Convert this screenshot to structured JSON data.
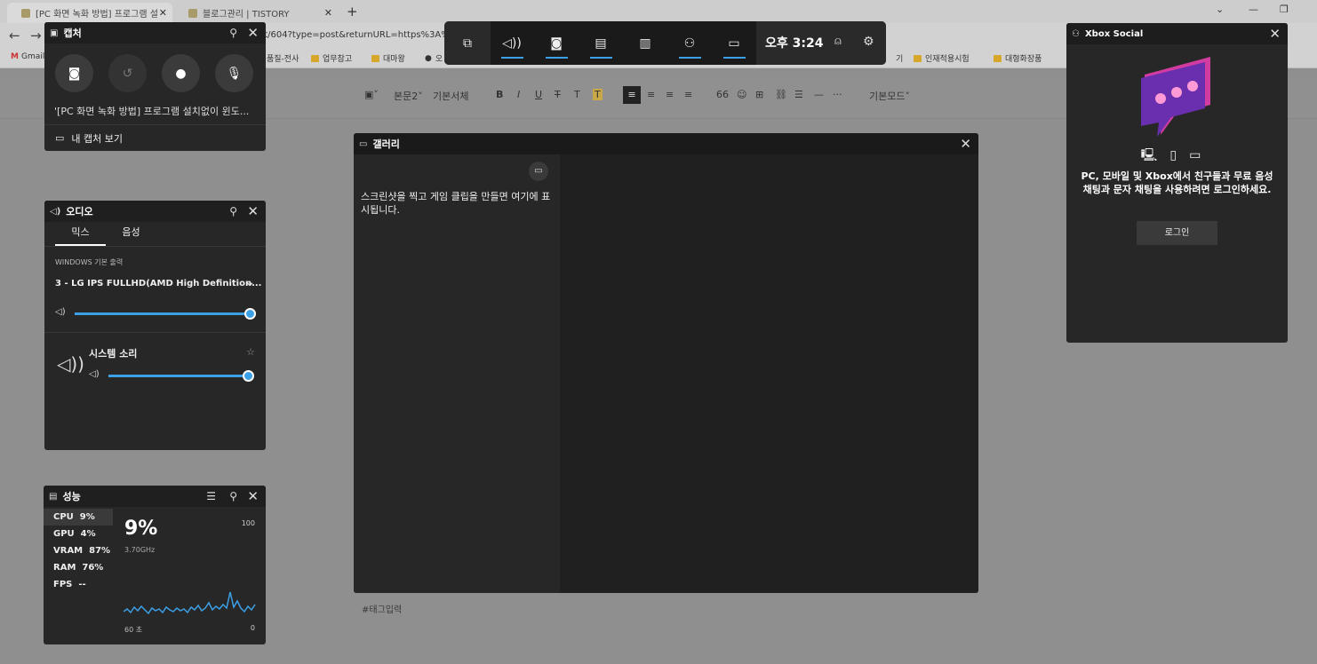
{
  "browser": {
    "tabs": [
      {
        "title": "[PC 화면 녹화 방법] 프로그램 설"
      },
      {
        "title": "블로그관리 | TISTORY"
      }
    ],
    "url": "st/604?type=post&returnURL=https%3A%",
    "bookmarks": [
      "Gmail",
      "품질-전사",
      "업무참고",
      "대마왕",
      "오",
      "기",
      "인재적용시험",
      "대형화장품"
    ],
    "editor": {
      "paragraph_style": "본문2",
      "font": "기본서체",
      "mode": "기본모드",
      "tag_placeholder": "#태그입력"
    }
  },
  "capture": {
    "title": "캡처",
    "caption": "'[PC 화면 녹화 방법] 프로그램 설치없이 윈도...",
    "view_captures": "내 캡처 보기"
  },
  "audio": {
    "title": "오디오",
    "tab_mix": "믹스",
    "tab_voice": "음성",
    "output_label": "WINDOWS 기본 출력",
    "device": "3 - LG IPS FULLHD(AMD High Definition...",
    "master_volume": 0.97,
    "app_name": "시스템 소리",
    "app_volume": 1.0
  },
  "performance": {
    "title": "성능",
    "metrics": [
      {
        "name": "CPU",
        "value": "9%"
      },
      {
        "name": "GPU",
        "value": "4%"
      },
      {
        "name": "VRAM",
        "value": "87%"
      },
      {
        "name": "RAM",
        "value": "76%"
      },
      {
        "name": "FPS",
        "value": "--"
      }
    ],
    "current": "9%",
    "frequency": "3.70GHz",
    "max": "100",
    "min": "0",
    "duration": "60 초"
  },
  "gamebar": {
    "time": "오후 3:24"
  },
  "gallery": {
    "title": "갤러리",
    "empty_message": "스크린샷을 찍고 게임 클립을 만들면 여기에 표시됩니다."
  },
  "social": {
    "title": "Xbox Social",
    "message": "PC, 모바일 및 Xbox에서 친구들과 무료 음성 채팅과 문자 채팅을 사용하려면 로그인하세요.",
    "login": "로그인"
  },
  "colors": {
    "accent": "#3ca0e6",
    "widget_bg": "#272727",
    "header_bg": "#1f1f1f"
  }
}
